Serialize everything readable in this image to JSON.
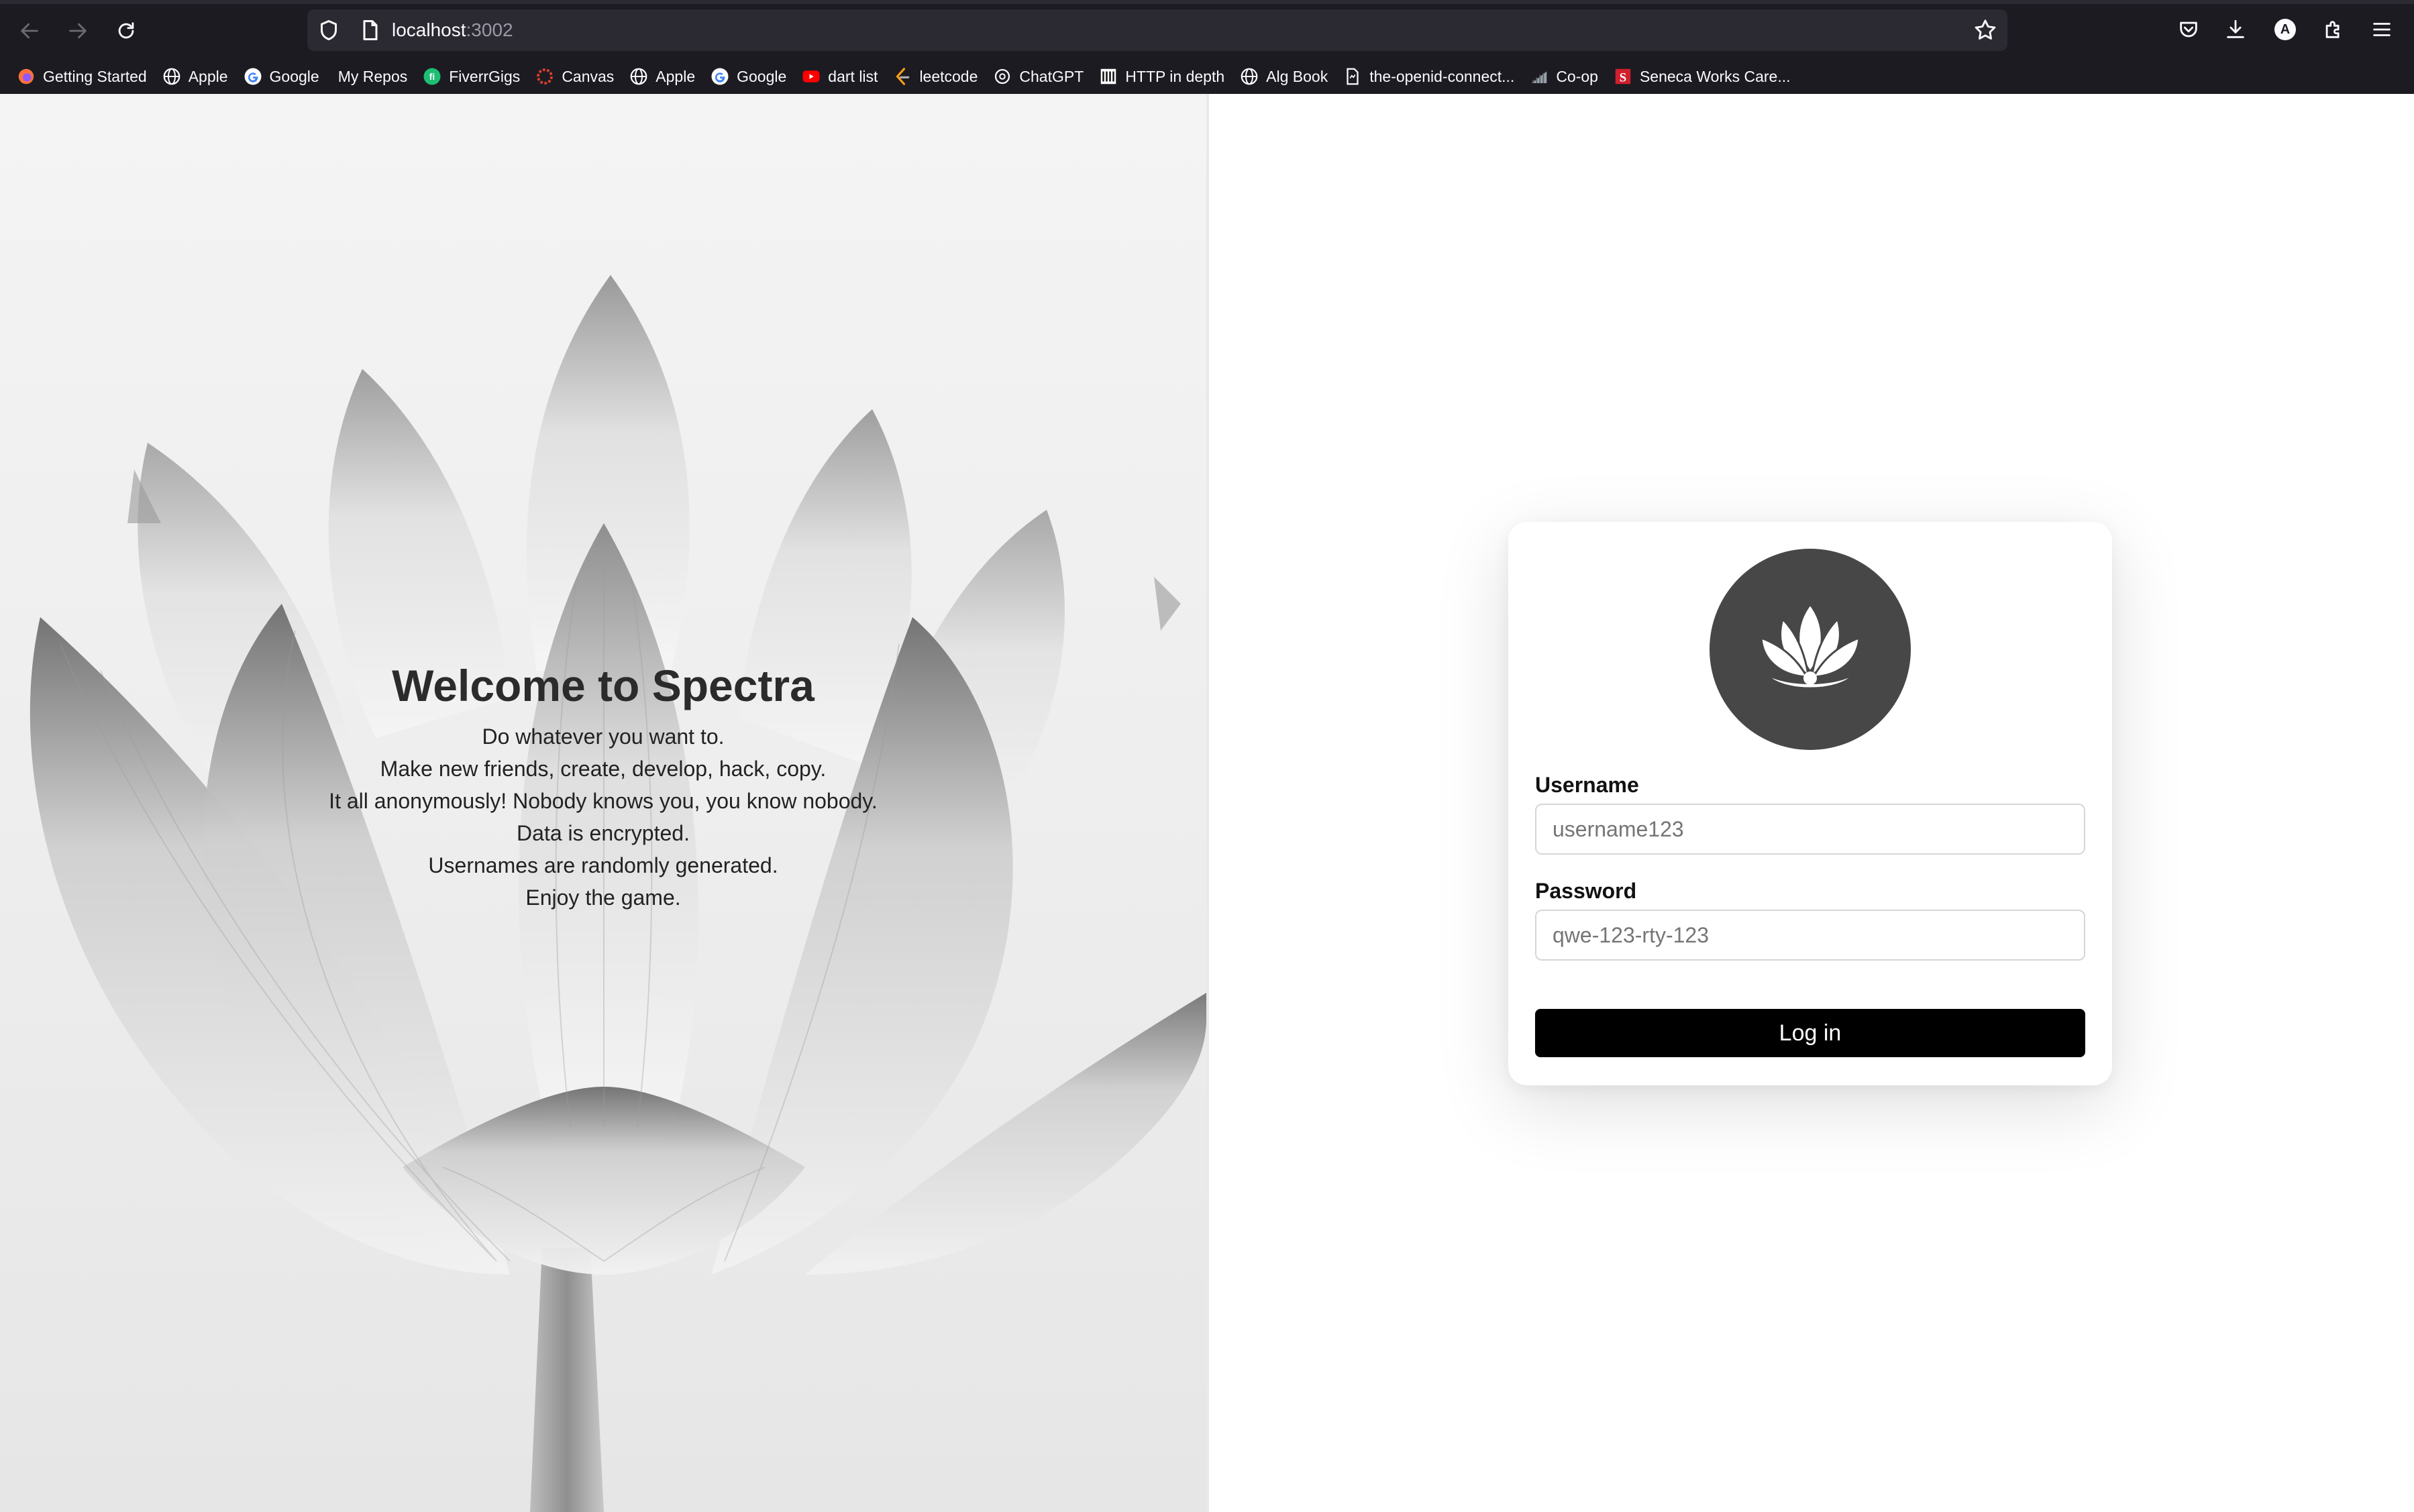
{
  "browser": {
    "url_host": "localhost",
    "url_port": ":3002",
    "account_initial": "A",
    "bookmarks": [
      {
        "label": "Getting Started",
        "icon": "firefox-icon"
      },
      {
        "label": "Apple",
        "icon": "globe-icon"
      },
      {
        "label": "Google",
        "icon": "google-icon"
      },
      {
        "label": "My Repos",
        "icon": "none"
      },
      {
        "label": "FiverrGigs",
        "icon": "fiverr-icon"
      },
      {
        "label": "Canvas",
        "icon": "canvas-icon"
      },
      {
        "label": "Apple",
        "icon": "globe-icon"
      },
      {
        "label": "Google",
        "icon": "google-icon"
      },
      {
        "label": "dart list",
        "icon": "youtube-icon"
      },
      {
        "label": "leetcode",
        "icon": "leetcode-icon"
      },
      {
        "label": "ChatGPT",
        "icon": "chatgpt-icon"
      },
      {
        "label": "HTTP in depth",
        "icon": "http-icon"
      },
      {
        "label": "Alg Book",
        "icon": "globe-icon"
      },
      {
        "label": "the-openid-connect...",
        "icon": "document-icon"
      },
      {
        "label": "Co-op",
        "icon": "chart-icon"
      },
      {
        "label": "Seneca Works Care...",
        "icon": "seneca-icon"
      }
    ]
  },
  "hero": {
    "title": "Welcome to Spectra",
    "lines": [
      "Do whatever you want to.",
      "Make new friends, create, develop, hack, copy.",
      "It all anonymously! Nobody knows you, you know nobody.",
      "Data is encrypted.",
      "Usernames are randomly generated.",
      "Enjoy the game."
    ]
  },
  "login": {
    "username_label": "Username",
    "username_placeholder": "username123",
    "password_label": "Password",
    "password_placeholder": "qwe-123-rty-123",
    "submit_label": "Log in"
  },
  "colors": {
    "chrome_bg": "#1c1b22",
    "urlbar_bg": "#2b2a33",
    "logo_bg": "#474747",
    "button_bg": "#000000"
  }
}
